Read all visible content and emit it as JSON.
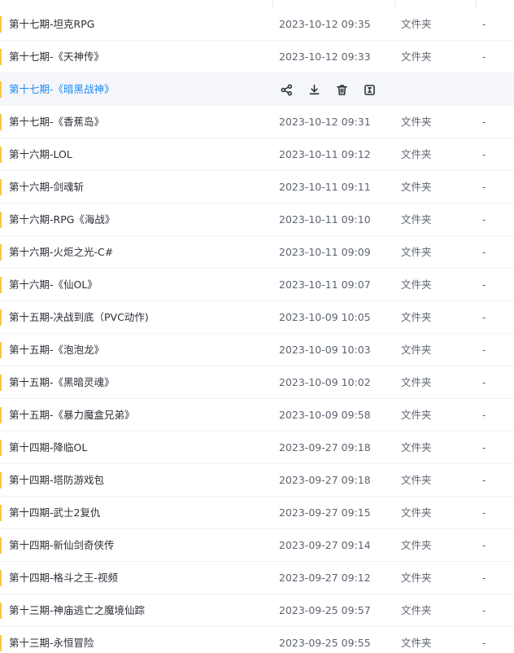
{
  "rows": [
    {
      "name": "第十七期-坦克RPG",
      "date": "2023-10-12 09:35",
      "type": "文件夹",
      "size": "-"
    },
    {
      "name": "第十七期-《天神传》",
      "date": "2023-10-12 09:33",
      "type": "文件夹",
      "size": "-"
    },
    {
      "name": "第十七期-《暗黑战神》",
      "hovered": true
    },
    {
      "name": "第十七期-《香蕉岛》",
      "date": "2023-10-12 09:31",
      "type": "文件夹",
      "size": "-"
    },
    {
      "name": "第十六期-LOL",
      "date": "2023-10-11 09:12",
      "type": "文件夹",
      "size": "-"
    },
    {
      "name": "第十六期-剑魂斩",
      "date": "2023-10-11 09:11",
      "type": "文件夹",
      "size": "-"
    },
    {
      "name": "第十六期-RPG《海战》",
      "date": "2023-10-11 09:10",
      "type": "文件夹",
      "size": "-"
    },
    {
      "name": "第十六期-火炬之光-C#",
      "date": "2023-10-11 09:09",
      "type": "文件夹",
      "size": "-"
    },
    {
      "name": "第十六期-《仙OL》",
      "date": "2023-10-11 09:07",
      "type": "文件夹",
      "size": "-"
    },
    {
      "name": "第十五期-决战到底（PVC动作)",
      "date": "2023-10-09 10:05",
      "type": "文件夹",
      "size": "-"
    },
    {
      "name": "第十五期-《泡泡龙》",
      "date": "2023-10-09 10:03",
      "type": "文件夹",
      "size": "-"
    },
    {
      "name": "第十五期-《黑暗灵魂》",
      "date": "2023-10-09 10:02",
      "type": "文件夹",
      "size": "-"
    },
    {
      "name": "第十五期-《暴力魔盒兄弟》",
      "date": "2023-10-09 09:58",
      "type": "文件夹",
      "size": "-"
    },
    {
      "name": "第十四期-降临OL",
      "date": "2023-09-27 09:18",
      "type": "文件夹",
      "size": "-"
    },
    {
      "name": "第十四期-塔防游戏包",
      "date": "2023-09-27 09:18",
      "type": "文件夹",
      "size": "-"
    },
    {
      "name": "第十四期-武士2复仇",
      "date": "2023-09-27 09:15",
      "type": "文件夹",
      "size": "-"
    },
    {
      "name": "第十四期-新仙剑奇侠传",
      "date": "2023-09-27 09:14",
      "type": "文件夹",
      "size": "-"
    },
    {
      "name": "第十四期-格斗之王-视频",
      "date": "2023-09-27 09:12",
      "type": "文件夹",
      "size": "-"
    },
    {
      "name": "第十三期-神庙逃亡之魔境仙踪",
      "date": "2023-09-25 09:57",
      "type": "文件夹",
      "size": "-"
    },
    {
      "name": "第十三期-永恒冒险",
      "date": "2023-09-25 09:55",
      "type": "文件夹",
      "size": "-"
    }
  ],
  "hover_actions": [
    {
      "icon": "share-icon"
    },
    {
      "icon": "download-icon"
    },
    {
      "icon": "trash-icon"
    },
    {
      "icon": "rename-icon"
    }
  ],
  "colors": {
    "accent": "#1f8bf0",
    "folder_marker": "#f7c843",
    "hover_bg": "#f4f6fb",
    "text": "#2b2f36",
    "secondary_text": "#5d6470"
  }
}
